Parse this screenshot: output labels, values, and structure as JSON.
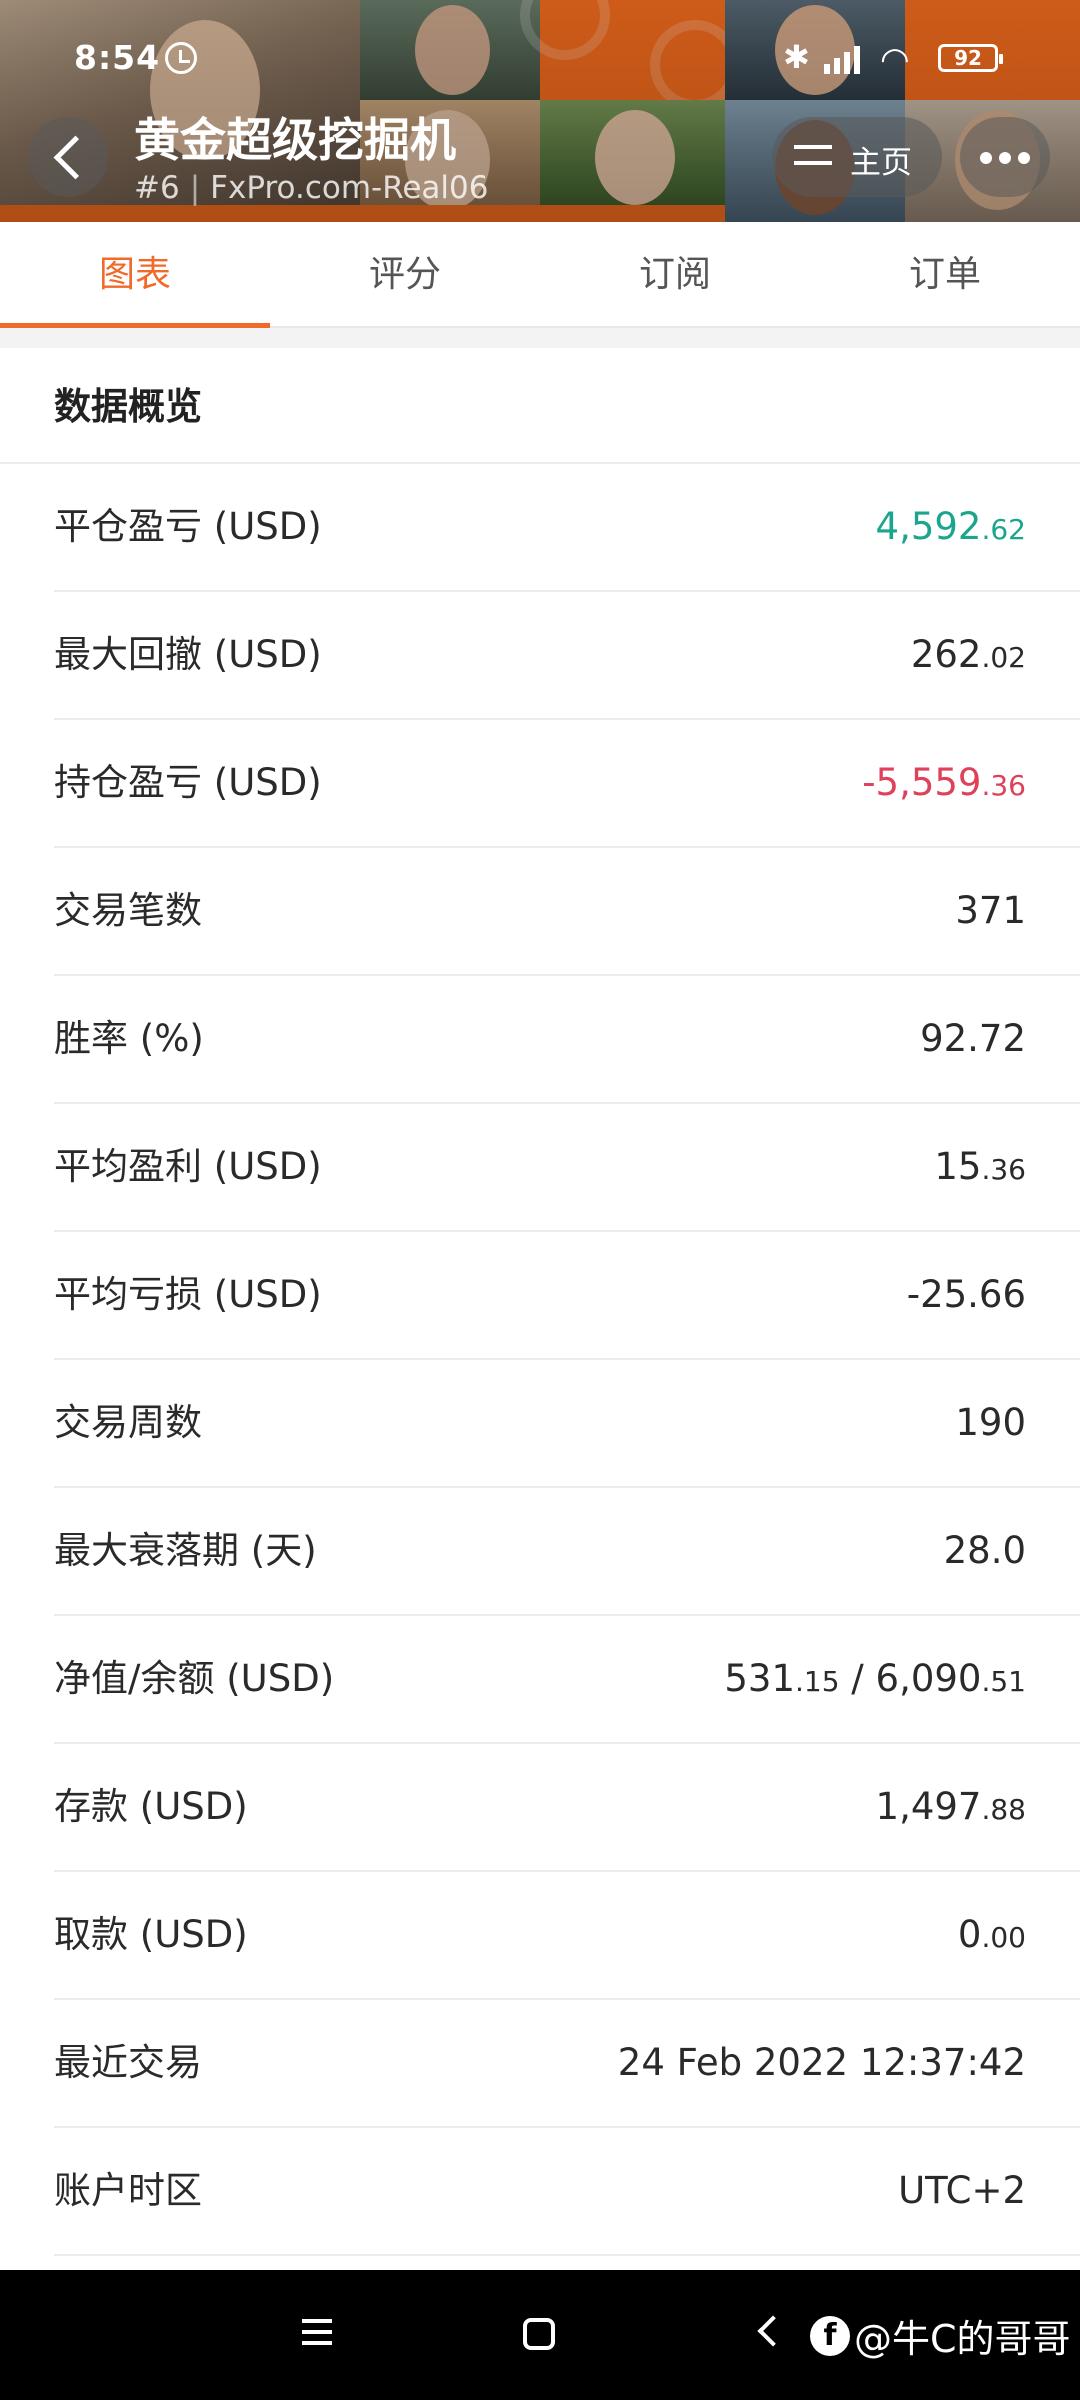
{
  "status_bar": {
    "time": "8:54",
    "battery": "92"
  },
  "header": {
    "title": "黄金超级挖掘机",
    "rank": "#6",
    "account": "FxPro.com-Real06",
    "home_label": "主页"
  },
  "tabs": [
    {
      "label": "图表",
      "active": true
    },
    {
      "label": "评分",
      "active": false
    },
    {
      "label": "订阅",
      "active": false
    },
    {
      "label": "订单",
      "active": false
    }
  ],
  "section": {
    "title": "数据概览"
  },
  "rows": [
    {
      "label": "平仓盈亏 (USD)",
      "int": "4,592",
      "dec": ".62",
      "color": "#1aa58c"
    },
    {
      "label": "最大回撤 (USD)",
      "int": "262",
      "dec": ".02",
      "color": ""
    },
    {
      "label": "持仓盈亏 (USD)",
      "int": "-5,559",
      "dec": ".36",
      "color": "#e0415a"
    },
    {
      "label": "交易笔数",
      "int": "371",
      "dec": "",
      "color": ""
    },
    {
      "label": "胜率 (%)",
      "int": "92.72",
      "dec": "",
      "color": ""
    },
    {
      "label": "平均盈利 (USD)",
      "int": "15",
      "dec": ".36",
      "color": ""
    },
    {
      "label": "平均亏损 (USD)",
      "int": "-25.66",
      "dec": "",
      "color": ""
    },
    {
      "label": "交易周数",
      "int": "190",
      "dec": "",
      "color": ""
    },
    {
      "label": "最大衰落期 (天)",
      "int": "28.0",
      "dec": "",
      "color": ""
    },
    {
      "label": "净值/余额 (USD)",
      "int": "531",
      "dec": ".15",
      "int2": " / 6,090",
      "dec2": ".51",
      "color": ""
    },
    {
      "label": "存款 (USD)",
      "int": "1,497",
      "dec": ".88",
      "color": ""
    },
    {
      "label": "取款 (USD)",
      "int": "0",
      "dec": ".00",
      "color": ""
    },
    {
      "label": "最近交易",
      "int": "24 Feb 2022 12:37:42",
      "dec": "",
      "color": ""
    },
    {
      "label": "账户时区",
      "int": "UTC+2",
      "dec": "",
      "color": ""
    }
  ],
  "watermark": {
    "text": "@牛C的哥哥",
    "logo": "f"
  },
  "icons": [
    "alarm-icon",
    "bluetooth-icon",
    "signal-icon",
    "wifi-icon",
    "battery-icon",
    "back-icon",
    "swap-icon",
    "more-icon",
    "menu-icon",
    "home-icon",
    "back-nav-icon"
  ]
}
